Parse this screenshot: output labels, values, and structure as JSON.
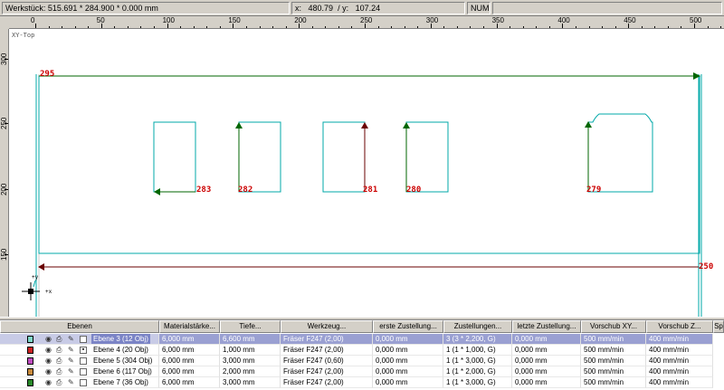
{
  "status": {
    "workpiece": "Werkstück: 515.691 * 284.900 * 0.000 mm",
    "x_label": "x:",
    "x_value": "480.79",
    "y_label": "/ y:",
    "y_value": "107.24",
    "num": "NUM"
  },
  "ruler": {
    "h_ticks": [
      "0",
      "50",
      "100",
      "150",
      "200",
      "250",
      "300",
      "350",
      "400",
      "450",
      "500"
    ],
    "v_ticks": [
      "300",
      "250",
      "200",
      "150"
    ]
  },
  "canvas": {
    "view_label": "XY-Top",
    "points": [
      "295",
      "283",
      "282",
      "281",
      "280",
      "279",
      "250"
    ],
    "axis_x": "+x",
    "axis_y": "+y"
  },
  "layers": {
    "columns": [
      "Ebenen",
      "Materialstärke...",
      "Tiefe...",
      "Werkzeug...",
      "erste Zustellung...",
      "Zustellungen...",
      "letzte Zustellung...",
      "Vorschub XY...",
      "Vorschub Z...",
      "Sp"
    ],
    "rows": [
      {
        "color": "#7fd8c8",
        "name": "Ebene 3 (12 Obj)",
        "mat": "6,000 mm",
        "depth": "6,600 mm",
        "tool": "Fräser F247 (2,00)",
        "first": "0,000 mm",
        "steps": "3 (3 * 2,200, G)",
        "last": "0,000 mm",
        "fxy": "500 mm/min",
        "fz": "400 mm/min",
        "selected": true
      },
      {
        "color": "#cc2222",
        "name": "Ebene 4 (20 Obj)",
        "mat": "6,000 mm",
        "depth": "1,000 mm",
        "tool": "Fräser F247 (2,00)",
        "first": "0,000 mm",
        "steps": "1 (1 * 1,000, G)",
        "last": "0,000 mm",
        "fxy": "500 mm/min",
        "fz": "400 mm/min",
        "selected": false
      },
      {
        "color": "#c04cc0",
        "name": "Ebene 5 (304 Obj)",
        "mat": "6,000 mm",
        "depth": "3,000 mm",
        "tool": "Fräser F247 (0,60)",
        "first": "0,000 mm",
        "steps": "1 (1 * 3,000, G)",
        "last": "0,000 mm",
        "fxy": "500 mm/min",
        "fz": "400 mm/min",
        "selected": false
      },
      {
        "color": "#c88a3c",
        "name": "Ebene 6 (117 Obj)",
        "mat": "6,000 mm",
        "depth": "2,000 mm",
        "tool": "Fräser F247 (2,00)",
        "first": "0,000 mm",
        "steps": "1 (1 * 2,000, G)",
        "last": "0,000 mm",
        "fxy": "500 mm/min",
        "fz": "400 mm/min",
        "selected": false
      },
      {
        "color": "#2a8a2a",
        "name": "Ebene 7 (36 Obj)",
        "mat": "6,000 mm",
        "depth": "3,000 mm",
        "tool": "Fräser F247 (2,00)",
        "first": "0,000 mm",
        "steps": "1 (1 * 3,000, G)",
        "last": "0,000 mm",
        "fxy": "500 mm/min",
        "fz": "400 mm/min",
        "selected": false
      }
    ]
  },
  "colors": {
    "contour": "#00a8a8",
    "arrow_green": "#006600",
    "arrow_dark": "#6a0000",
    "label_red": "#cc0000",
    "selection": "#7b84c6"
  }
}
